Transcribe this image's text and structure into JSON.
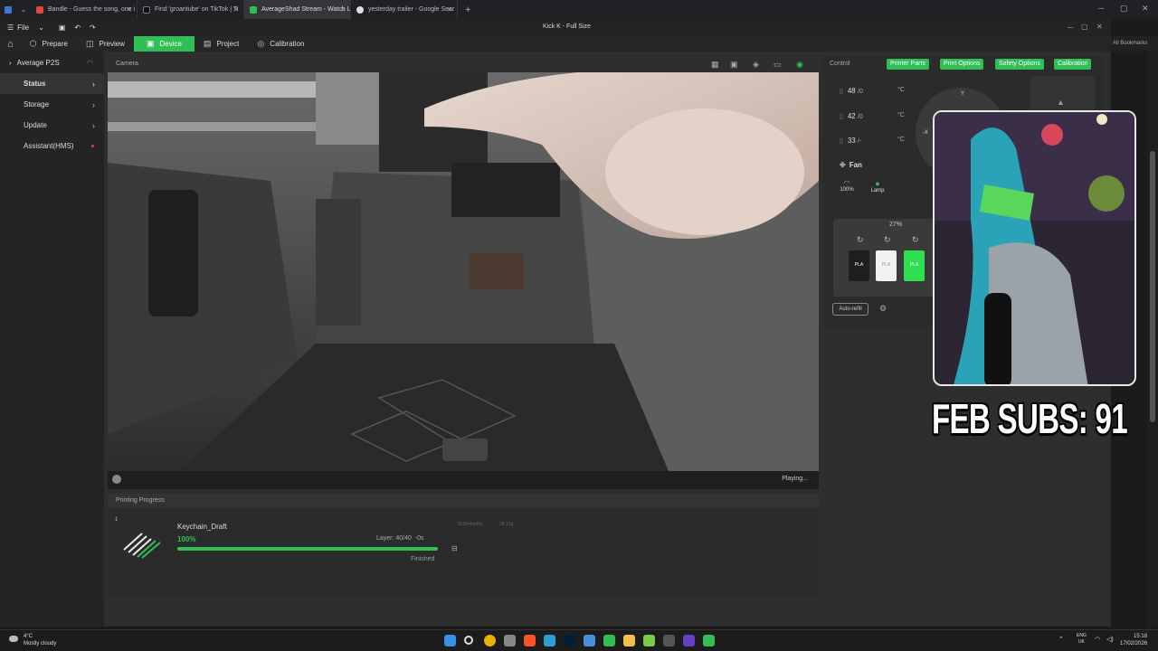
{
  "browser": {
    "tabs": [
      {
        "title": "Bandle - Guess the song, one i",
        "color": "#e4473c"
      },
      {
        "title": "Find 'groantube' on TikTok | Ti",
        "color": "#111111"
      },
      {
        "title": "AverageShad Stream - Watch L",
        "color": "#2fbf56"
      },
      {
        "title": "yesterday trailer - Google Sear",
        "color": "#dddddd"
      }
    ],
    "new_tab": "+",
    "bookmarks_label": "All Bookmarks"
  },
  "app": {
    "menu_label": "File",
    "title": "Kick K - Full Size"
  },
  "nav": {
    "items": [
      {
        "label": "Prepare",
        "icon": "prepare-icon"
      },
      {
        "label": "Preview",
        "icon": "preview-icon"
      },
      {
        "label": "Device",
        "icon": "device-icon"
      },
      {
        "label": "Project",
        "icon": "project-icon"
      },
      {
        "label": "Calibration",
        "icon": "calibration-icon"
      }
    ],
    "active": "Device"
  },
  "sidebar": {
    "printer_name": "Average P2S",
    "items": [
      {
        "label": "Status"
      },
      {
        "label": "Storage"
      },
      {
        "label": "Update"
      },
      {
        "label": "Assistant(HMS)"
      }
    ]
  },
  "camera": {
    "label": "Camera",
    "status": "Playing..."
  },
  "progress": {
    "label": "Printing Progress",
    "plate_index": "1",
    "job_name": "Keychain_Draft",
    "percent_text": "100%",
    "percent_value": 100,
    "layer_text": "Layer: 40/40",
    "time_left": "-0s",
    "state": "Finished",
    "meta_time": "5h2m4m56s",
    "meta_weight": "28.17g"
  },
  "control": {
    "label": "Control",
    "buttons": [
      "Printer Parts",
      "Print Options",
      "Safety Options",
      "Calibration"
    ],
    "temps": [
      {
        "value": "48",
        "target": "/0",
        "unit": "°C"
      },
      {
        "value": "42",
        "target": "/0",
        "unit": "°C"
      },
      {
        "value": "33",
        "target": "/-",
        "unit": "°C"
      }
    ],
    "fan_label": "Fan",
    "fan_speed": "100%",
    "lamp_label": "Lamp",
    "jog_y": "Y",
    "jog_x": "-X",
    "ams_humidity": "27%",
    "slots": [
      {
        "label": "PLA",
        "bg": "#1e1e1e",
        "fg": "#ffffff"
      },
      {
        "label": "PLA",
        "bg": "#f2f2f2",
        "fg": "#999999"
      },
      {
        "label": "PLA",
        "bg": "#2fe04e",
        "fg": "#ffffff"
      }
    ],
    "auto_refill": "Auto-refill"
  },
  "overlay": {
    "subs_text": "FEB SUBS: 91"
  },
  "taskbar": {
    "temperature": "4°C",
    "weather": "Mostly cloudy",
    "lang_1": "ENG",
    "lang_2": "UK",
    "time": "15:18",
    "date": "17/02/2026"
  },
  "colors": {
    "accent": "#2fbf56",
    "background": "#2e2e2e"
  }
}
